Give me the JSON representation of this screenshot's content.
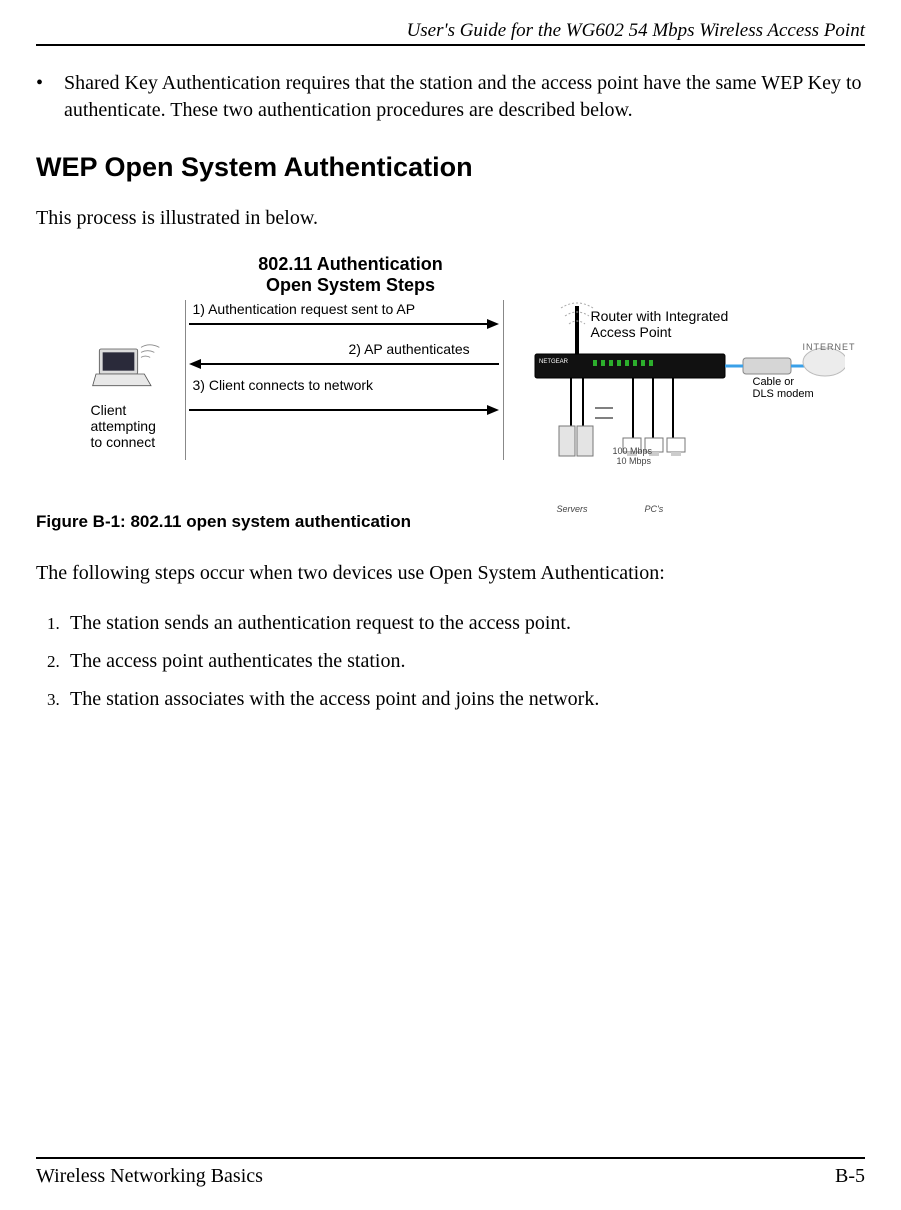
{
  "header": {
    "running_title": "User's Guide for the WG602 54 Mbps Wireless Access Point"
  },
  "bullet": {
    "text": "Shared Key Authentication requires that the station and the access point have the same WEP Key to authenticate. These two authentication procedures are described below."
  },
  "section": {
    "title": "WEP Open System Authentication",
    "intro": "This process is illustrated in below."
  },
  "figure": {
    "title_line1": "802.11 Authentication",
    "title_line2": "Open System Steps",
    "step1": "1) Authentication request sent to AP",
    "step2": "2) AP authenticates",
    "step3": "3) Client connects to network",
    "client_line1": "Client",
    "client_line2": "attempting",
    "client_line3": "to connect",
    "router_line1": "Router with Integrated",
    "router_line2": "Access Point",
    "modem_line1": "Cable or",
    "modem_line2": "DLS modem",
    "internet_label": "INTERNET",
    "speed_line1": "100 Mbps",
    "speed_line2": "10 Mbps",
    "servers_label": "Servers",
    "pcs_label": "PC's",
    "netgear_label": "NETGEAR",
    "caption": "Figure B-1:  802.11 open system authentication"
  },
  "body": {
    "lead_in": "The following steps occur when two devices use Open System Authentication:",
    "steps": [
      "The station sends an authentication request to the access point.",
      "The access point authenticates the station.",
      "The station associates with the access point and joins the network."
    ]
  },
  "footer": {
    "left": "Wireless Networking Basics",
    "right": "B-5"
  }
}
